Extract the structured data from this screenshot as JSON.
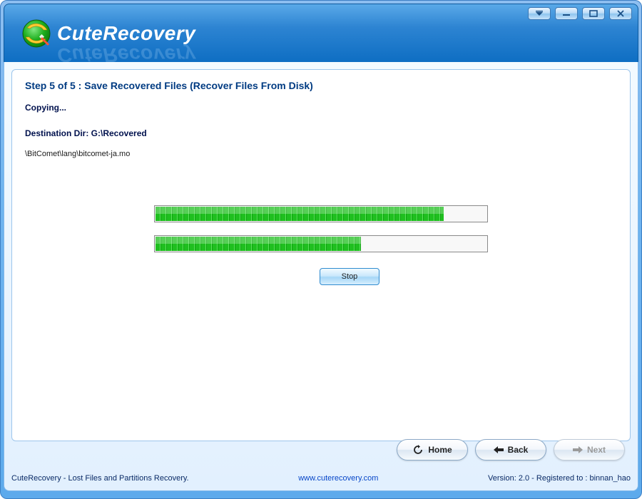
{
  "app": {
    "name": "CuteRecovery"
  },
  "step": {
    "title": "Step 5 of 5 : Save Recovered Files (Recover Files From Disk)",
    "status": "Copying...",
    "dest_label": "Destination Dir: ",
    "dest_value": "G:\\Recovered",
    "current_file": "\\BitComet\\lang\\bitcomet-ja.mo"
  },
  "progress": {
    "file_percent": 87,
    "overall_percent": 62
  },
  "buttons": {
    "stop": "Stop",
    "home": "Home",
    "back": "Back",
    "next": "Next"
  },
  "status": {
    "left": "CuteRecovery - Lost Files and Partitions Recovery.",
    "url": "www.cuterecovery.com",
    "right": "Version: 2.0 - Registered to : binnan_hao"
  }
}
